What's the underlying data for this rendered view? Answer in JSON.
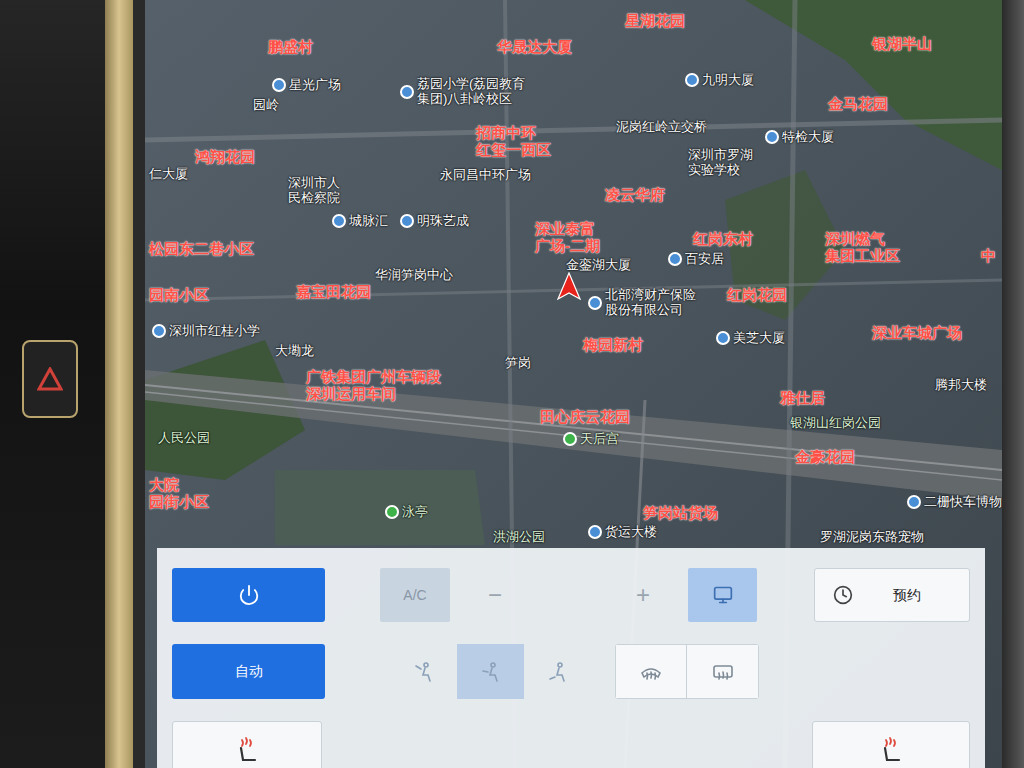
{
  "map": {
    "labels": [
      {
        "kind": "area",
        "lines": [
          "鹏盛村"
        ]
      },
      {
        "kind": "area",
        "lines": [
          "华晟达大厦"
        ]
      },
      {
        "kind": "area",
        "lines": [
          "星湖花园"
        ]
      },
      {
        "kind": "area",
        "lines": [
          "银湖半山"
        ]
      },
      {
        "kind": "poi",
        "lines": [
          "星光广场"
        ]
      },
      {
        "kind": "poi",
        "lines": [
          "荔园小学(荔园教育",
          "集团)八卦岭校区"
        ]
      },
      {
        "kind": "poi",
        "lines": [
          "九明大厦"
        ]
      },
      {
        "kind": "area",
        "lines": [
          "金马花园"
        ]
      },
      {
        "kind": "label",
        "lines": [
          "园岭"
        ]
      },
      {
        "kind": "area",
        "lines": [
          "招商中环",
          "红玺一西区"
        ]
      },
      {
        "kind": "label",
        "lines": [
          "泥岗红岭立交桥"
        ]
      },
      {
        "kind": "poi",
        "lines": [
          "特检大厦"
        ]
      },
      {
        "kind": "label",
        "lines": [
          "深圳市罗湖",
          "实验学校"
        ]
      },
      {
        "kind": "area",
        "lines": [
          "鸿翔花园"
        ]
      },
      {
        "kind": "label",
        "lines": [
          "深圳市人",
          "民检察院"
        ]
      },
      {
        "kind": "label",
        "lines": [
          "仁大厦"
        ]
      },
      {
        "kind": "label",
        "lines": [
          "永同昌中环广场"
        ]
      },
      {
        "kind": "area",
        "lines": [
          "凌云华府"
        ]
      },
      {
        "kind": "poi",
        "lines": [
          "城脉汇"
        ]
      },
      {
        "kind": "poi",
        "lines": [
          "明珠艺成"
        ]
      },
      {
        "kind": "area",
        "lines": [
          "深业泰富",
          "广场-二期"
        ]
      },
      {
        "kind": "area",
        "lines": [
          "红岗东村"
        ]
      },
      {
        "kind": "area",
        "lines": [
          "深圳燃气",
          "集团工业区"
        ]
      },
      {
        "kind": "area",
        "lines": [
          "松园东二巷小区"
        ]
      },
      {
        "kind": "label",
        "lines": [
          "华润笋岗中心"
        ]
      },
      {
        "kind": "label",
        "lines": [
          "金銮湖大厦"
        ]
      },
      {
        "kind": "poi",
        "lines": [
          "百安居"
        ]
      },
      {
        "kind": "area",
        "lines": [
          "园南小区"
        ]
      },
      {
        "kind": "area",
        "lines": [
          "嘉宝田花园"
        ]
      },
      {
        "kind": "poi",
        "lines": [
          "北部湾财产保险",
          "股份有限公司"
        ]
      },
      {
        "kind": "area",
        "lines": [
          "红岗花园"
        ]
      },
      {
        "kind": "poi",
        "lines": [
          "深圳市红桂小学"
        ]
      },
      {
        "kind": "area",
        "lines": [
          "深业车城广场"
        ]
      },
      {
        "kind": "label",
        "lines": [
          "大墈龙"
        ]
      },
      {
        "kind": "label",
        "lines": [
          "笋岗"
        ]
      },
      {
        "kind": "area",
        "lines": [
          "梅园新村"
        ]
      },
      {
        "kind": "poi",
        "lines": [
          "美芝大厦"
        ]
      },
      {
        "kind": "label",
        "lines": [
          "腾邦大楼"
        ]
      },
      {
        "kind": "area",
        "lines": [
          "广铁集团广州车辆段",
          "深圳运用车间"
        ]
      },
      {
        "kind": "area",
        "lines": [
          "雅仕居"
        ]
      },
      {
        "kind": "area",
        "lines": [
          "田心庆云花园"
        ]
      },
      {
        "kind": "park-poi",
        "lines": [
          "天后宫"
        ]
      },
      {
        "kind": "park",
        "lines": [
          "人民公园"
        ]
      },
      {
        "kind": "park",
        "lines": [
          "银湖山红岗公园"
        ]
      },
      {
        "kind": "area",
        "lines": [
          "金豪花园"
        ]
      },
      {
        "kind": "area",
        "lines": [
          "大院",
          "园街小区"
        ]
      },
      {
        "kind": "park-poi",
        "lines": [
          "泳亭"
        ]
      },
      {
        "kind": "area",
        "lines": [
          "笋岗站货场"
        ]
      },
      {
        "kind": "poi",
        "lines": [
          "货运大楼"
        ]
      },
      {
        "kind": "park",
        "lines": [
          "洪湖公园"
        ]
      },
      {
        "kind": "poi",
        "lines": [
          "二栅快车博物"
        ]
      },
      {
        "kind": "label",
        "lines": [
          "罗湖泥岗东路宠物"
        ]
      },
      {
        "kind": "area",
        "lines": [
          "中"
        ]
      }
    ]
  },
  "climate": {
    "power": {
      "on": true
    },
    "auto": {
      "label": "自动",
      "selected": true
    },
    "ac": {
      "label": "A/C",
      "on": false
    },
    "fan": {
      "minus": "−",
      "plus": "+"
    },
    "recirculation": {
      "selected": true
    },
    "schedule": {
      "label": "预约"
    },
    "airflow_modes": [
      {
        "selected": false
      },
      {
        "selected": true
      },
      {
        "selected": false
      }
    ],
    "defrost": [
      {
        "kind": "front",
        "selected": false
      },
      {
        "kind": "rear",
        "selected": false
      }
    ]
  }
}
